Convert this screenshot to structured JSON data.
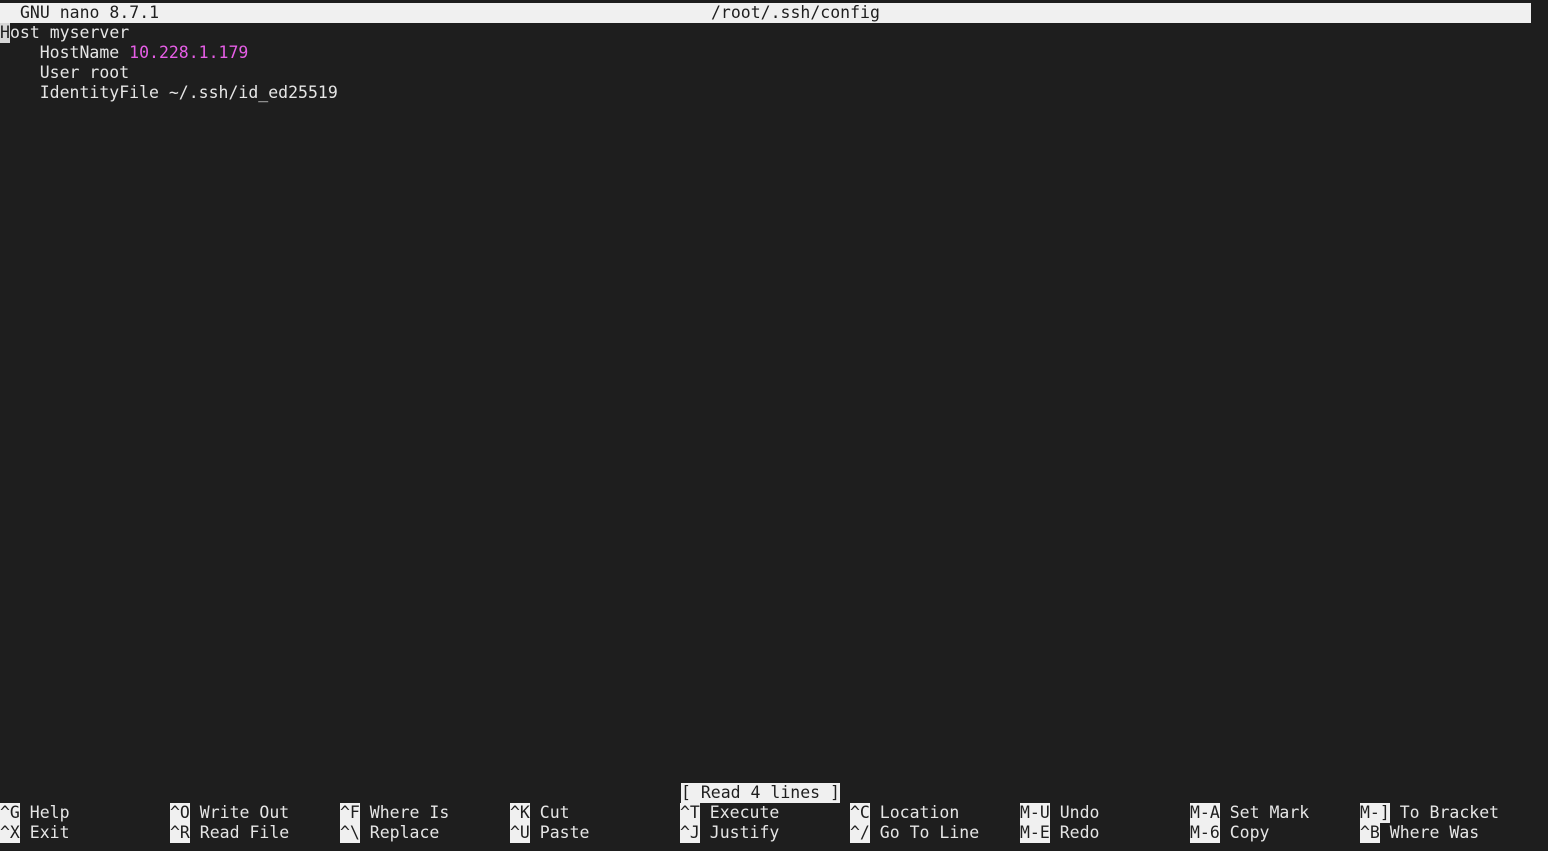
{
  "titlebar": {
    "version": "GNU nano 8.7.1",
    "filename": "/root/.ssh/config"
  },
  "editor": {
    "cursor_char": "H",
    "lines": [
      {
        "text_after_cursor": "ost myserver"
      },
      {
        "key": "    HostName ",
        "value": "10.228.1.179"
      },
      {
        "text": "    User root"
      },
      {
        "text": "    IdentityFile ~/.ssh/id_ed25519"
      }
    ]
  },
  "status_message": "[ Read 4 lines ]",
  "shortcuts": {
    "row1": [
      {
        "key": "^G",
        "label": " Help"
      },
      {
        "key": "^O",
        "label": " Write Out"
      },
      {
        "key": "^F",
        "label": " Where Is"
      },
      {
        "key": "^K",
        "label": " Cut"
      },
      {
        "key": "^T",
        "label": " Execute"
      },
      {
        "key": "^C",
        "label": " Location"
      },
      {
        "key": "M-U",
        "label": " Undo"
      },
      {
        "key": "M-A",
        "label": " Set Mark"
      },
      {
        "key": "M-]",
        "label": " To Bracket"
      }
    ],
    "row2": [
      {
        "key": "^X",
        "label": " Exit"
      },
      {
        "key": "^R",
        "label": " Read File"
      },
      {
        "key": "^\\",
        "label": " Replace"
      },
      {
        "key": "^U",
        "label": " Paste"
      },
      {
        "key": "^J",
        "label": " Justify"
      },
      {
        "key": "^/",
        "label": " Go To Line"
      },
      {
        "key": "M-E",
        "label": " Redo"
      },
      {
        "key": "M-6",
        "label": " Copy"
      },
      {
        "key": "^B",
        "label": " Where Was"
      }
    ]
  },
  "colors": {
    "background": "#1e1e1e",
    "foreground": "#e6e6e6",
    "inverse_bg": "#f0f0f0",
    "ip_highlight": "#e65ee6"
  }
}
